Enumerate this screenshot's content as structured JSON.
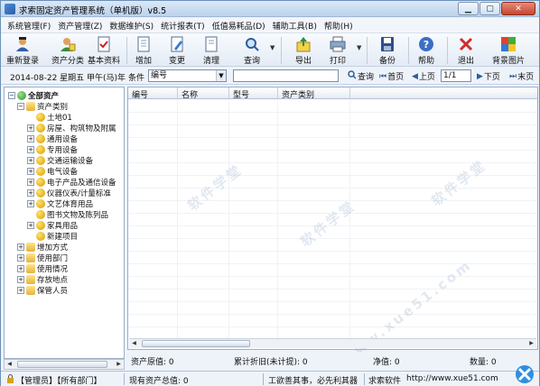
{
  "window": {
    "title": "求索固定资产管理系统（单机版）v8.5",
    "minimize": "▁",
    "maximize": "▢",
    "close": "✕"
  },
  "menu": [
    "系统管理(F)",
    "资产管理(Z)",
    "数据维护(S)",
    "统计报表(T)",
    "低值易耗品(D)",
    "辅助工具(B)",
    "帮助(H)"
  ],
  "toolbar": {
    "relogin": "重新登录",
    "classify": "资产分类",
    "basic": "基本资料",
    "add": "增加",
    "change": "变更",
    "clear": "清理",
    "query": "查询",
    "export": "导出",
    "print": "打印",
    "backup": "备份",
    "help": "帮助",
    "exit": "退出",
    "bg": "背景图片"
  },
  "filter": {
    "date": "2014-08-22  星期五  甲午(马)年",
    "cond_label": "条件",
    "cond_value": "编号",
    "search_value": "",
    "query_btn": "查询",
    "first": "首页",
    "prev": "上页",
    "page": "1/1",
    "next": "下页",
    "last": "末页"
  },
  "tree": {
    "root": "全部资产",
    "category": "资产类别",
    "categories": [
      "土地01",
      "房屋、构筑物及附属",
      "通用设备",
      "专用设备",
      "交通运输设备",
      "电气设备",
      "电子产品及通信设备",
      "仪器仪表/计量标准",
      "文艺体育用品",
      "图书文物及陈列品",
      "家具用品",
      "新建项目"
    ],
    "others": [
      "增加方式",
      "使用部门",
      "使用情况",
      "存放地点",
      "保管人员"
    ]
  },
  "grid": {
    "columns": [
      "编号",
      "名称",
      "型号",
      "资产类别"
    ]
  },
  "summary": {
    "original": "资产原值: 0",
    "depreciation": "累计折旧(未计提): 0",
    "net": "净值: 0",
    "count": "数量: 0"
  },
  "status": {
    "user": "【管理员】【所有部门】",
    "total": "现有资产总值: 0",
    "slogan": "工欲善其事，必先利其器",
    "brand": "求索软件",
    "url": "http://www.xue51.com"
  },
  "watermark": [
    "软件学堂",
    "www.xue51.com"
  ],
  "colors": {
    "accent": "#2a5ea8",
    "chrome": "#eef3fa",
    "close": "#c4462f"
  },
  "icons": [
    "user-icon",
    "category-icon",
    "document-icon",
    "add-icon",
    "edit-icon",
    "clear-icon",
    "search-icon",
    "export-icon",
    "printer-icon",
    "save-icon",
    "help-icon",
    "exit-icon",
    "image-icon"
  ]
}
